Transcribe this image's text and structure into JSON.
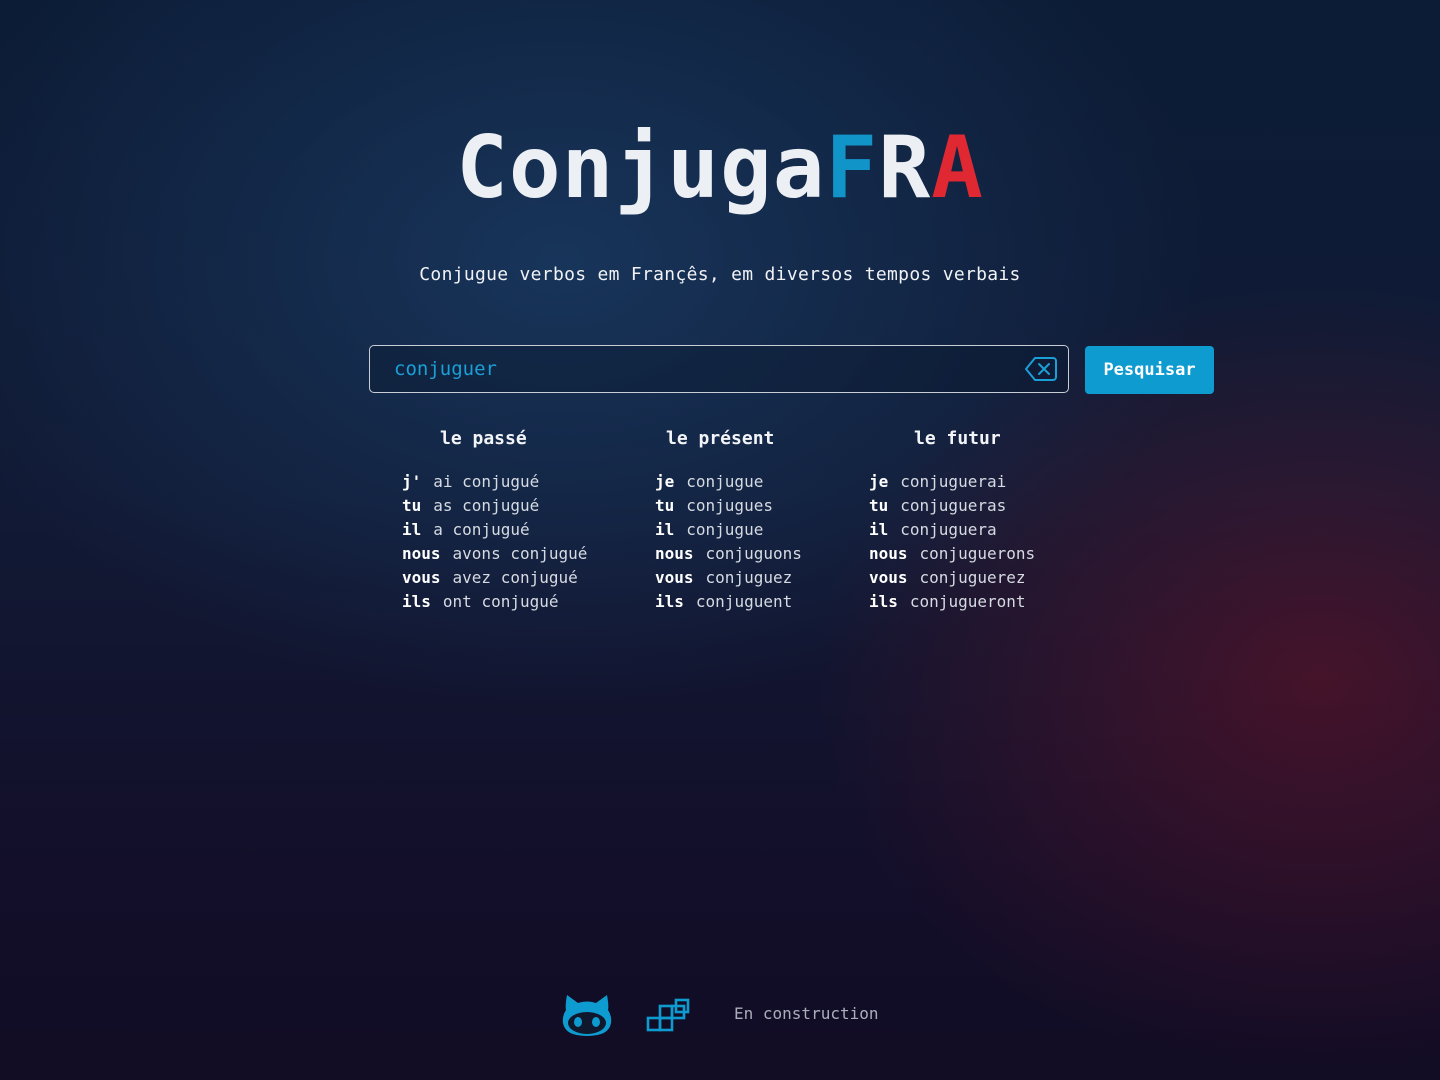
{
  "logo": {
    "base": "Conjuga",
    "f": "F",
    "r": "R",
    "a": "A"
  },
  "tagline": "Conjugue verbos em Françês, em diversos tempos verbais",
  "search": {
    "value": "conjuguer",
    "button_label": "Pesquisar",
    "clear_icon": "backspace-x-icon"
  },
  "tenses": [
    {
      "title": "le passé",
      "rows": [
        {
          "pronoun": "j'",
          "verb": "ai conjugué"
        },
        {
          "pronoun": "tu",
          "verb": "as conjugué"
        },
        {
          "pronoun": "il",
          "verb": "a conjugué"
        },
        {
          "pronoun": "nous",
          "verb": "avons conjugué"
        },
        {
          "pronoun": "vous",
          "verb": "avez conjugué"
        },
        {
          "pronoun": "ils",
          "verb": "ont conjugué"
        }
      ]
    },
    {
      "title": "le présent",
      "rows": [
        {
          "pronoun": "je",
          "verb": "conjugue"
        },
        {
          "pronoun": "tu",
          "verb": "conjugues"
        },
        {
          "pronoun": "il",
          "verb": "conjugue"
        },
        {
          "pronoun": "nous",
          "verb": "conjuguons"
        },
        {
          "pronoun": "vous",
          "verb": "conjuguez"
        },
        {
          "pronoun": "ils",
          "verb": "conjuguent"
        }
      ]
    },
    {
      "title": "le futur",
      "rows": [
        {
          "pronoun": "je",
          "verb": "conjuguerai"
        },
        {
          "pronoun": "tu",
          "verb": "conjugueras"
        },
        {
          "pronoun": "il",
          "verb": "conjuguera"
        },
        {
          "pronoun": "nous",
          "verb": "conjuguerons"
        },
        {
          "pronoun": "vous",
          "verb": "conjuguerez"
        },
        {
          "pronoun": "ils",
          "verb": "conjugueront"
        }
      ]
    }
  ],
  "footer": {
    "github_icon": "github-icon",
    "blocks_icon": "blocks-icon",
    "status_text": "En construction"
  },
  "colors": {
    "accent_blue": "#0e9bd0",
    "accent_red": "#e02832",
    "text_light": "#eceff3"
  }
}
